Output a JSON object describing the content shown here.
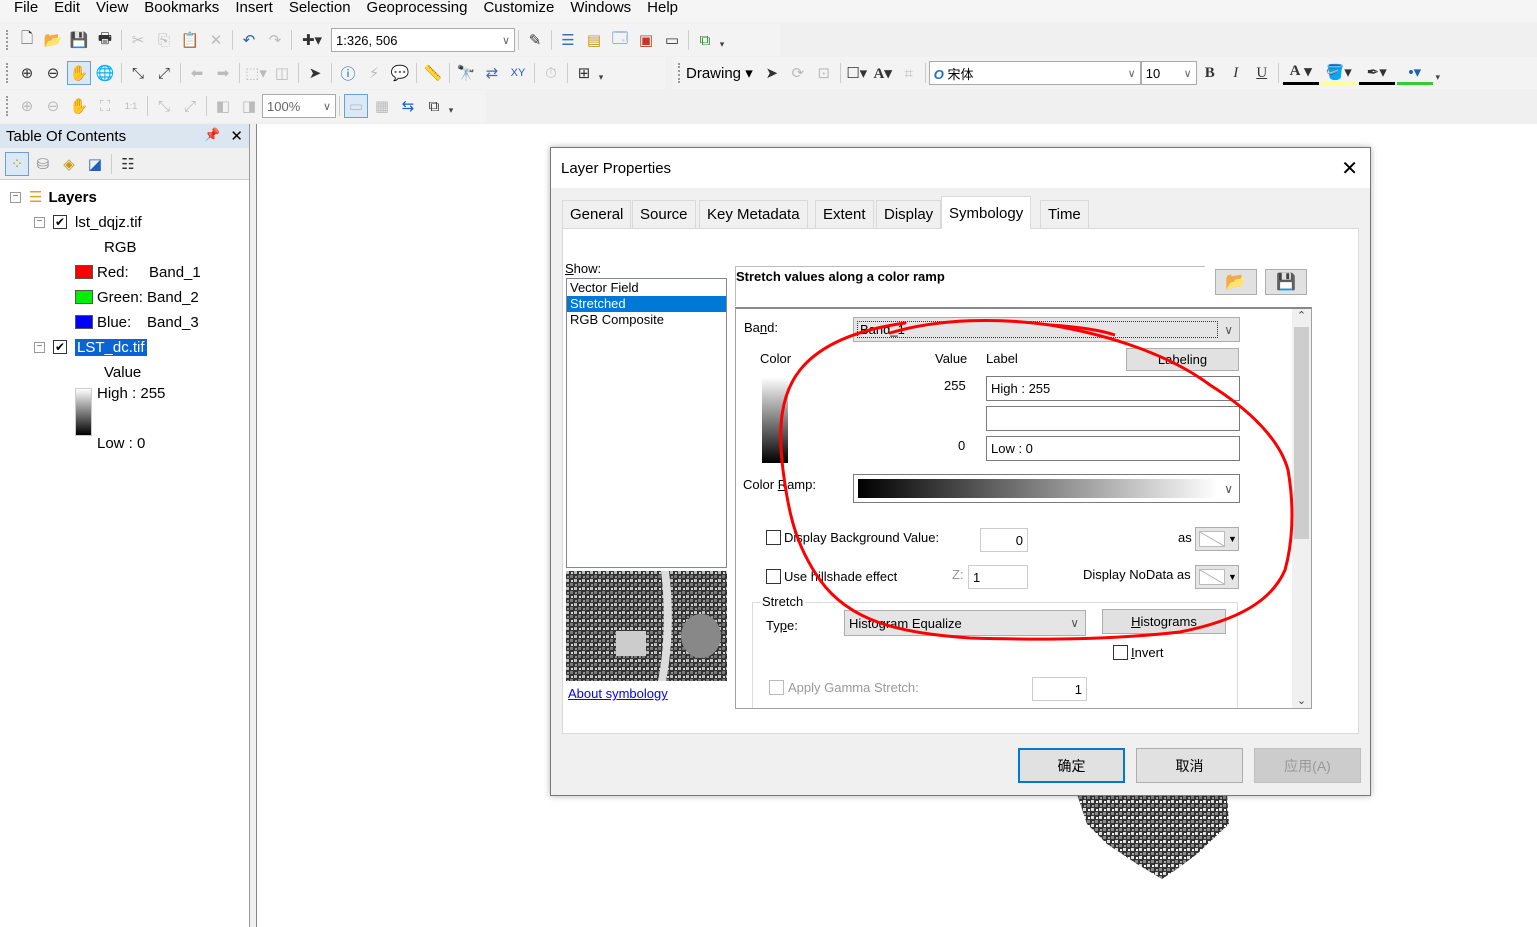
{
  "menubar": {
    "items": [
      "File",
      "Edit",
      "View",
      "Bookmarks",
      "Insert",
      "Selection",
      "Geoprocessing",
      "Customize",
      "Windows",
      "Help"
    ]
  },
  "toolbar1": {
    "buttons": [
      "new-document",
      "open",
      "save",
      "print",
      "cut",
      "copy",
      "paste",
      "delete",
      "undo",
      "redo",
      "add-data"
    ],
    "scale_value": "1:326, 506",
    "trailing_buttons": [
      "editor-toolbar",
      "table-of-contents",
      "catalog",
      "search",
      "arctoolbox",
      "python",
      "model-builder"
    ]
  },
  "toolbar2": {
    "buttons": [
      "zoom-in",
      "zoom-out",
      "pan",
      "full-extent",
      "fixed-zoom-in",
      "fixed-zoom-out",
      "go-back",
      "go-forward",
      "select-features",
      "clear-selection",
      "select-elements",
      "identify",
      "hyperlink",
      "html-popup",
      "measure",
      "find",
      "find-route",
      "go-to-xy",
      "time-slider",
      "create-viewer-window"
    ]
  },
  "drawing_toolbar": {
    "label": "Drawing",
    "font_name": "宋体",
    "font_size": "10",
    "bold": "B",
    "italic": "I",
    "underline": "U",
    "font_color_glyph": "A",
    "colors": {
      "font": "#000000",
      "fill": "#ffff99",
      "line": "#000000",
      "marker": "#33cc33"
    }
  },
  "layout_toolbar": {
    "zoom_value": "100%"
  },
  "toc": {
    "title": "Table Of Contents",
    "pin": "⚖",
    "close": "✕",
    "root": "Layers",
    "layers": [
      {
        "name": "lst_dqjz.tif",
        "checked": true,
        "legend_title": "RGB",
        "bands": [
          {
            "label": "Red:",
            "band": "Band_1",
            "color": "#ff0000"
          },
          {
            "label": "Green:",
            "band": "Band_2",
            "color": "#00ee00"
          },
          {
            "label": "Blue:",
            "band": "Band_3",
            "color": "#0000ff"
          }
        ]
      },
      {
        "name": "LST_dc.tif",
        "checked": true,
        "selected": true,
        "legend_title": "Value",
        "high": "High : 255",
        "low": "Low : 0"
      }
    ]
  },
  "dialog": {
    "title": "Layer Properties",
    "tabs": [
      "General",
      "Source",
      "Key Metadata",
      "Extent",
      "Display",
      "Symbology",
      "Time"
    ],
    "active_tab": "Symbology",
    "show_label": "Show:",
    "show_items": [
      "Vector Field",
      "Stretched",
      "RGB Composite"
    ],
    "selected_show": "Stretched",
    "about_link": "About symbology",
    "description": "Stretch values along a color ramp",
    "band_label": "Band:",
    "band_value": "Band_1",
    "color_header": "Color",
    "value_header": "Value",
    "label_header": "Label",
    "labeling_button": "Labeling",
    "high_value": "255",
    "high_label": "High : 255",
    "mid_label": "",
    "low_value": "0",
    "low_label": "Low : 0",
    "color_ramp_label": "Color Ramp:",
    "display_background_label": "Display Background Value:",
    "display_background_checked": false,
    "background_value": "0",
    "as_label": "as",
    "hillshade_label": "Use hillshade effect",
    "hillshade_checked": false,
    "z_label": "Z:",
    "z_value": "1",
    "nodata_label": "Display NoData as",
    "stretch_group": "Stretch",
    "type_label": "Type:",
    "stretch_type": "Histogram Equalize",
    "histograms_button": "Histograms",
    "invert_label": "Invert",
    "invert_checked": false,
    "gamma_label": "Apply Gamma Stretch:",
    "gamma_value": "1",
    "ok_button": "确定",
    "cancel_button": "取消",
    "apply_button": "应用(A)"
  },
  "annotation": {
    "color": "#ff0000",
    "shape": "freehand-circle"
  }
}
